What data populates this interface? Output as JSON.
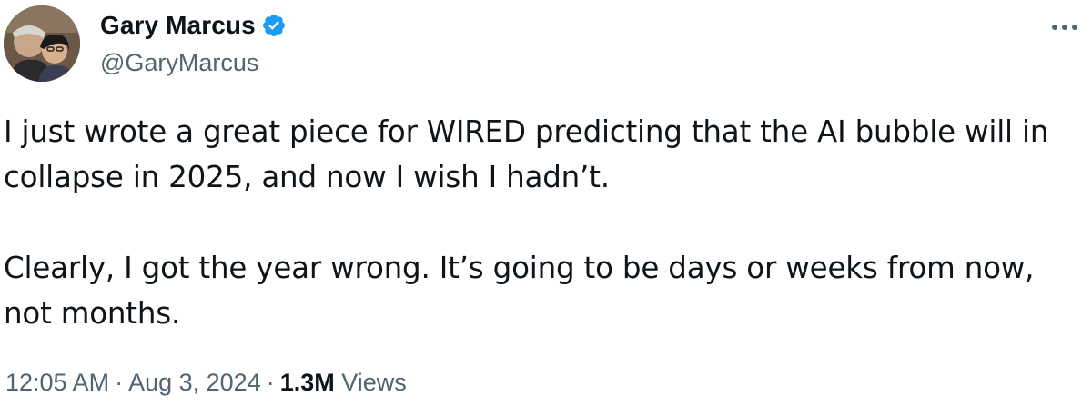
{
  "author": {
    "display_name": "Gary Marcus",
    "handle": "@GaryMarcus",
    "verified_icon": "verified-badge-icon",
    "avatar_icon": "avatar-photo"
  },
  "tweet": {
    "paragraphs": [
      "I just wrote a great piece for WIRED predicting that the AI bubble will in collapse in 2025, and now I wish I hadn’t.",
      "Clearly, I got the year wrong. It’s going to be days or weeks from now, not months."
    ],
    "time": "12:05 AM",
    "separator": "·",
    "date": "Aug 3, 2024",
    "views_count": "1.3M",
    "views_label": "Views"
  },
  "menu": {
    "icon": "more-options-icon"
  },
  "colors": {
    "text_primary": "#0f1419",
    "text_secondary": "#536471",
    "verified_blue": "#1d9bf0"
  }
}
